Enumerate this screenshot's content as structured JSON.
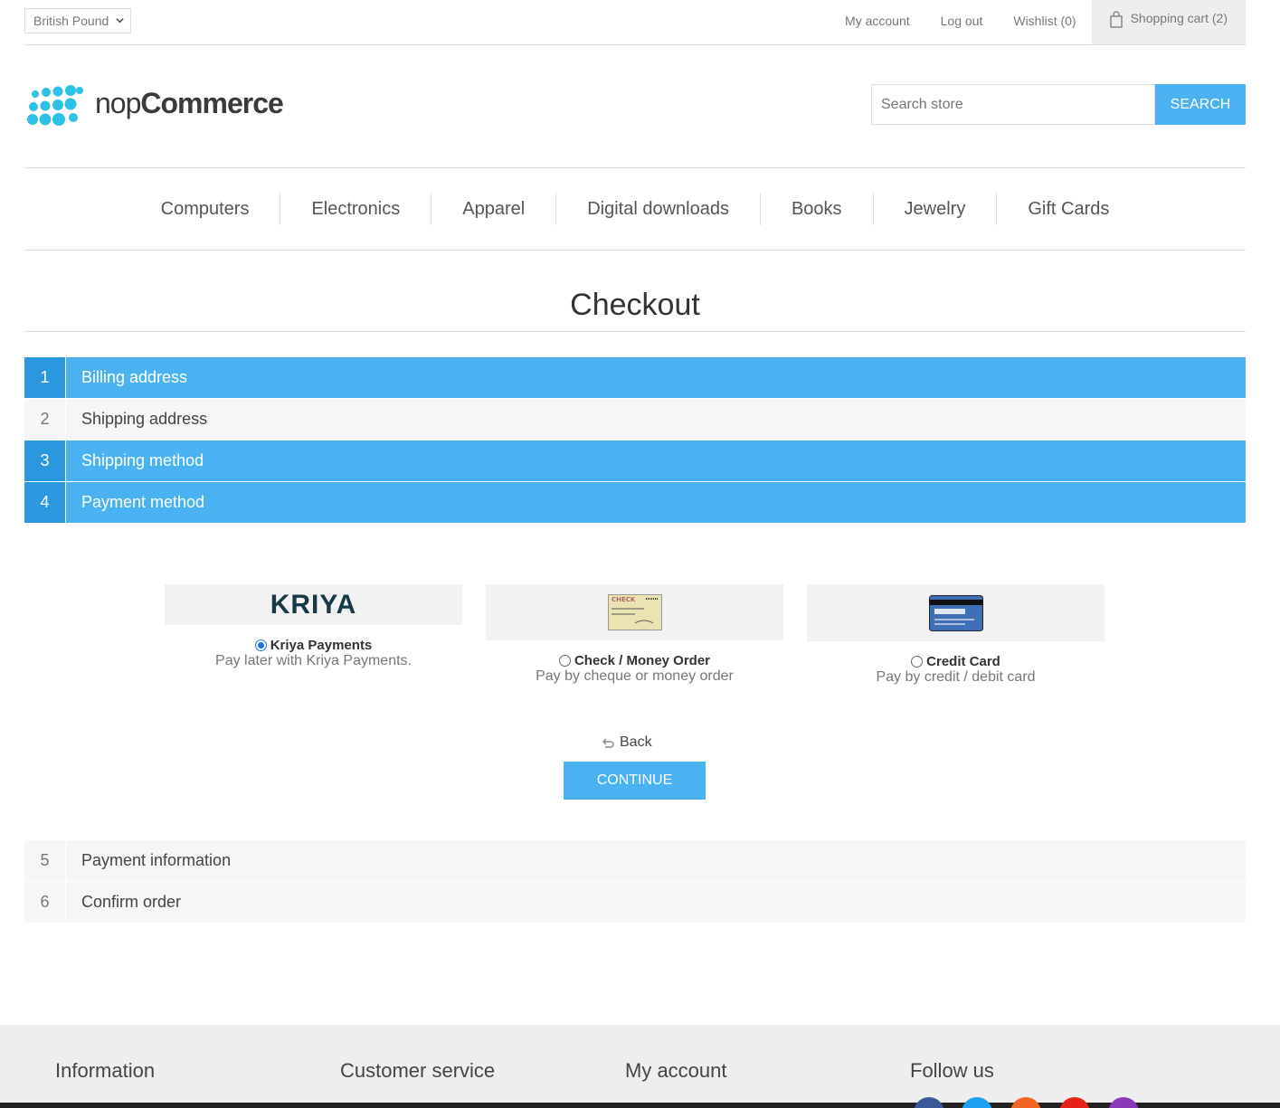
{
  "header": {
    "currency": "British Pound",
    "links": {
      "my_account": "My account",
      "log_out": "Log out",
      "wishlist": "Wishlist (0)",
      "cart": "Shopping cart (2)"
    }
  },
  "logo": {
    "prefix": "nop",
    "suffix": "Commerce"
  },
  "search": {
    "placeholder": "Search store",
    "button": "SEARCH"
  },
  "menu": [
    "Computers",
    "Electronics",
    "Apparel",
    "Digital downloads",
    "Books",
    "Jewelry",
    "Gift Cards"
  ],
  "page_title": "Checkout",
  "steps": [
    {
      "num": "1",
      "label": "Billing address",
      "state": "active"
    },
    {
      "num": "2",
      "label": "Shipping address",
      "state": "inactive"
    },
    {
      "num": "3",
      "label": "Shipping method",
      "state": "active"
    },
    {
      "num": "4",
      "label": "Payment method",
      "state": "active"
    },
    {
      "num": "5",
      "label": "Payment information",
      "state": "inactive"
    },
    {
      "num": "6",
      "label": "Confirm order",
      "state": "inactive"
    }
  ],
  "payment_methods": [
    {
      "logo_text": "KRIYA",
      "name": "Kriya Payments",
      "desc": "Pay later with Kriya Payments.",
      "selected": true
    },
    {
      "logo_text": "CHECK",
      "name": "Check / Money Order",
      "desc": "Pay by cheque or money order",
      "selected": false
    },
    {
      "logo_text": "",
      "name": "Credit Card",
      "desc": "Pay by credit / debit card",
      "selected": false
    }
  ],
  "actions": {
    "back": "Back",
    "continue": "CONTINUE"
  },
  "footer": {
    "columns": [
      "Information",
      "Customer service",
      "My account",
      "Follow us"
    ]
  },
  "colors": {
    "accent": "#4ab2f1",
    "accent_dark": "#2a97de",
    "logo_dots": "#2fc0e6"
  }
}
